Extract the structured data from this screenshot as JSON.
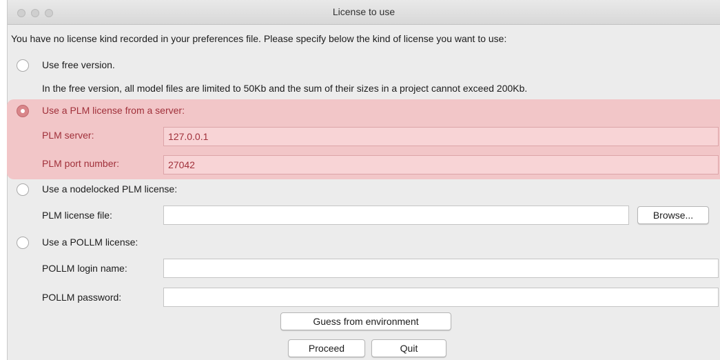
{
  "window": {
    "title": "License to use"
  },
  "intro_text": "You have no license kind recorded in your preferences file. Please specify below the kind of license you want to use:",
  "options": {
    "free": {
      "label": "Use free version.",
      "description": "In the free version, all model files are limited to 50Kb and the sum of their sizes in a project cannot exceed 200Kb.",
      "selected": false
    },
    "plm_server": {
      "label": "Use a PLM license from a server:",
      "selected": true,
      "server_label": "PLM server:",
      "server_value": "127.0.0.1",
      "port_label": "PLM port number:",
      "port_value": "27042"
    },
    "nodelocked": {
      "label": "Use a nodelocked PLM license:",
      "selected": false,
      "file_label": "PLM license file:",
      "file_value": "",
      "browse_label": "Browse..."
    },
    "pollm": {
      "label": "Use a POLLM license:",
      "selected": false,
      "login_label": "POLLM login name:",
      "login_value": "",
      "password_label": "POLLM password:",
      "password_value": ""
    }
  },
  "buttons": {
    "guess_label": "Guess from environment",
    "proceed_label": "Proceed",
    "quit_label": "Quit"
  },
  "colors": {
    "selection_highlight": "#f2c6c8",
    "selection_text": "#a0303a",
    "window_background": "#ececec"
  }
}
